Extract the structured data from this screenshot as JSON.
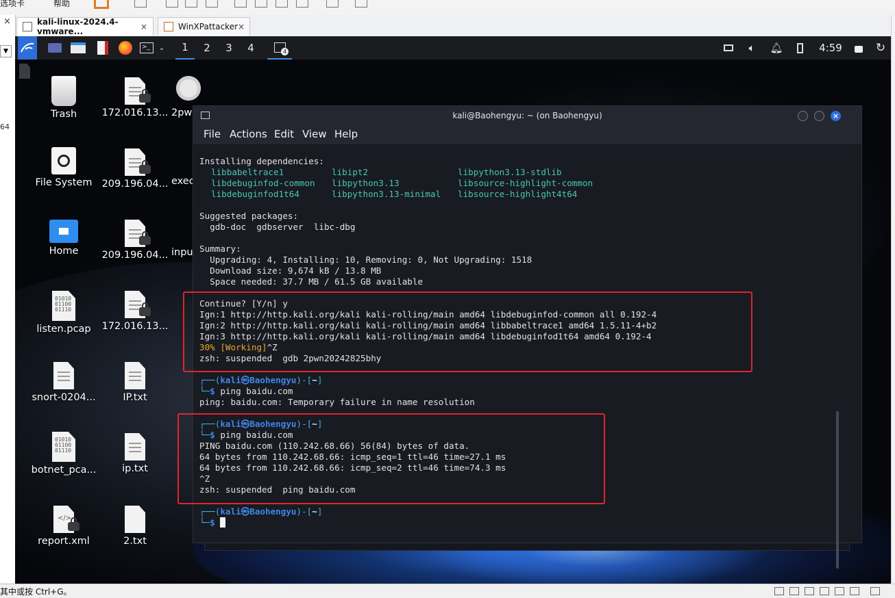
{
  "host": {
    "toolbar_labels": [
      "选项卡",
      "帮助"
    ],
    "tabs": [
      {
        "label": "kali-linux-2024.4-vmware...",
        "close": "×",
        "active": true
      },
      {
        "label": "WinXPattacker",
        "close": "×",
        "active": false
      }
    ],
    "left_pane": {
      "close": "×",
      "dropdown": "▼",
      "number": "64"
    },
    "status_text": "其中或按 Ctrl+G。"
  },
  "panel": {
    "workspaces": [
      "1",
      "2",
      "3",
      "4"
    ],
    "active_workspace": "1",
    "terminal_badge": "4",
    "clock": "4:59"
  },
  "desktop": {
    "icons": [
      {
        "label": "Trash",
        "icon": "trash-icon"
      },
      {
        "label": "172.016.13...",
        "icon": "locked-file-icon"
      },
      {
        "label": "2pw",
        "icon": "gear-icon"
      },
      {
        "label": "File System",
        "icon": "drive-icon"
      },
      {
        "label": "209.196.04...",
        "icon": "locked-file-icon"
      },
      {
        "label": "exec",
        "icon": "file-icon"
      },
      {
        "label": "Home",
        "icon": "home-folder-icon"
      },
      {
        "label": "209.196.04...",
        "icon": "locked-file-icon"
      },
      {
        "label": "inpu",
        "icon": "file-icon"
      },
      {
        "label": "listen.pcap",
        "icon": "pcap-file-icon"
      },
      {
        "label": "172.016.13...",
        "icon": "locked-file-icon"
      },
      {
        "label": "snort-0204...",
        "icon": "text-file-icon"
      },
      {
        "label": "IP.txt",
        "icon": "text-file-icon"
      },
      {
        "label": "botnet_pca...",
        "icon": "pcap-file-icon"
      },
      {
        "label": "ip.txt",
        "icon": "text-file-icon"
      },
      {
        "label": "report.xml",
        "icon": "locked-xml-icon"
      },
      {
        "label": "2.txt",
        "icon": "file-icon"
      }
    ]
  },
  "terminal": {
    "title": "kali@Baohengyu: ~ (on Baohengyu)",
    "menu": [
      "File",
      "Actions",
      "Edit",
      "View",
      "Help"
    ],
    "install_header": "Installing dependencies:",
    "packages": [
      [
        "libbabeltrace1",
        "libipt2",
        "libpython3.13-stdlib"
      ],
      [
        "libdebuginfod-common",
        "libpython3.13",
        "libsource-highlight-common"
      ],
      [
        "libdebuginfod1t64",
        "libpython3.13-minimal",
        "libsource-highlight4t64"
      ]
    ],
    "suggested_header": "Suggested packages:",
    "suggested": "  gdb-doc  gdbserver  libc-dbg",
    "summary_header": "Summary:",
    "summary_lines": [
      "  Upgrading: 4, Installing: 10, Removing: 0, Not Upgrading: 1518",
      "  Download size: 9,674 kB / 13.8 MB",
      "  Space needed: 37.7 MB / 61.5 GB available"
    ],
    "continue_line": "Continue? [Y/n] y",
    "ign_lines": [
      "Ign:1 http://http.kali.org/kali kali-rolling/main amd64 libdebuginfod-common all 0.192-4",
      "Ign:2 http://http.kali.org/kali kali-rolling/main amd64 libbabeltrace1 amd64 1.5.11-4+b2",
      "Ign:3 http://http.kali.org/kali kali-rolling/main amd64 libdebuginfod1t64 amd64 0.192-4"
    ],
    "progress_pct": "30%",
    "progress_status": "[Working]",
    "progress_tail": "^Z",
    "suspended_gdb": "zsh: suspended  gdb 2pwn20242825bhy",
    "prompt_user": "kali㉿Baohengyu",
    "prompt_dir": "~",
    "cmd_ping": "ping baidu.com",
    "ping_fail": "ping: baidu.com: Temporary failure in name resolution",
    "ping_ok_lines": [
      "PING baidu.com (110.242.68.66) 56(84) bytes of data.",
      "64 bytes from 110.242.68.66: icmp_seq=1 ttl=46 time=27.1 ms",
      "64 bytes from 110.242.68.66: icmp_seq=2 ttl=46 time=74.3 ms",
      "^Z",
      "zsh: suspended  ping baidu.com"
    ],
    "highlight_color": "#e0262c"
  }
}
